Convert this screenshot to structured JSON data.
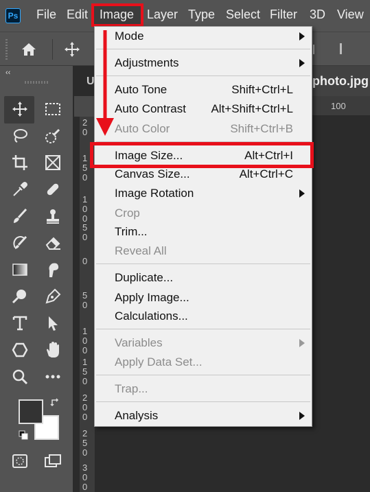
{
  "app": {
    "logo_text": "Ps",
    "accent": "#31a8ff"
  },
  "menubar": {
    "items": [
      "File",
      "Edit",
      "Image",
      "Layer",
      "Type",
      "Select",
      "Filter",
      "3D",
      "View"
    ],
    "active": "Image"
  },
  "tab": {
    "title_left": "U",
    "title_right": "photo.jpg"
  },
  "ruler": {
    "h_label": "100",
    "v_labels": [
      "2\n0",
      "1\n5\n0",
      "1\n0\n0",
      "5\n0",
      "0",
      "5\n0",
      "1\n0\n0",
      "1\n5\n0",
      "2\n0\n0",
      "2\n5\n0",
      "3\n0\n0"
    ]
  },
  "toolbar": {
    "collapse_icon": "double-chevron-left-icon",
    "tools": [
      "move-icon",
      "marquee-icon",
      "lasso-icon",
      "quick-select-icon",
      "crop-icon",
      "frame-icon",
      "eyedropper-icon",
      "healing-icon",
      "brush-icon",
      "stamp-icon",
      "history-brush-icon",
      "eraser-icon",
      "gradient-icon",
      "smudge-icon",
      "dodge-icon",
      "pen-icon",
      "type-icon",
      "path-select-icon",
      "shape-icon",
      "hand-icon",
      "zoom-icon",
      "more-icon"
    ]
  },
  "image_menu": {
    "items": [
      {
        "label": "Mode",
        "shortcut": "",
        "submenu": true,
        "disabled": false
      },
      {
        "label": "Adjustments",
        "shortcut": "",
        "submenu": true,
        "disabled": false
      },
      {
        "label": "Auto Tone",
        "shortcut": "Shift+Ctrl+L",
        "submenu": false,
        "disabled": false
      },
      {
        "label": "Auto Contrast",
        "shortcut": "Alt+Shift+Ctrl+L",
        "submenu": false,
        "disabled": false
      },
      {
        "label": "Auto Color",
        "shortcut": "Shift+Ctrl+B",
        "submenu": false,
        "disabled": true
      },
      {
        "label": "Image Size...",
        "shortcut": "Alt+Ctrl+I",
        "submenu": false,
        "disabled": false
      },
      {
        "label": "Canvas Size...",
        "shortcut": "Alt+Ctrl+C",
        "submenu": false,
        "disabled": false
      },
      {
        "label": "Image Rotation",
        "shortcut": "",
        "submenu": true,
        "disabled": false
      },
      {
        "label": "Crop",
        "shortcut": "",
        "submenu": false,
        "disabled": true
      },
      {
        "label": "Trim...",
        "shortcut": "",
        "submenu": false,
        "disabled": false
      },
      {
        "label": "Reveal All",
        "shortcut": "",
        "submenu": false,
        "disabled": true
      },
      {
        "label": "Duplicate...",
        "shortcut": "",
        "submenu": false,
        "disabled": false
      },
      {
        "label": "Apply Image...",
        "shortcut": "",
        "submenu": false,
        "disabled": false
      },
      {
        "label": "Calculations...",
        "shortcut": "",
        "submenu": false,
        "disabled": false
      },
      {
        "label": "Variables",
        "shortcut": "",
        "submenu": true,
        "disabled": true
      },
      {
        "label": "Apply Data Set...",
        "shortcut": "",
        "submenu": false,
        "disabled": true
      },
      {
        "label": "Trap...",
        "shortcut": "",
        "submenu": false,
        "disabled": true
      },
      {
        "label": "Analysis",
        "shortcut": "",
        "submenu": true,
        "disabled": false
      }
    ],
    "highlighted": "Image Size..."
  },
  "annotation": {
    "color": "#e8101b"
  }
}
